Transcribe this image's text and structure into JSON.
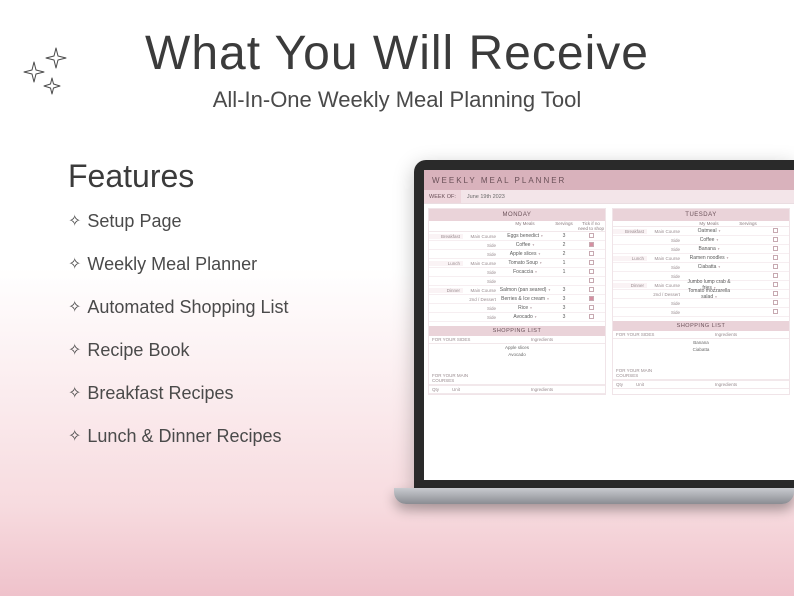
{
  "header": {
    "title": "What You Will Receive",
    "subtitle": "All-In-One Weekly Meal Planning Tool"
  },
  "features": {
    "heading": "Features",
    "items": [
      "Setup Page",
      "Weekly Meal Planner",
      "Automated Shopping List",
      "Recipe Book",
      "Breakfast Recipes",
      "Lunch & Dinner Recipes"
    ]
  },
  "planner": {
    "app_title": "WEEKLY MEAL PLANNER",
    "week_label": "WEEK OF:",
    "week_value": "June 19th 2023",
    "col_mymeals": "My Meals",
    "col_servings": "Servings",
    "col_tick": "Tick if no need to shop",
    "meal_groups": [
      "Breakfast",
      "Lunch",
      "Dinner"
    ],
    "row_labels": [
      "Main Course",
      "Side",
      "Side",
      "Main Course",
      "Side",
      "Side",
      "Main Course",
      "2nd / Dessert",
      "Side",
      "Side"
    ],
    "days": [
      {
        "name": "MONDAY",
        "rows": [
          {
            "val": "Eggs benedict",
            "serv": "3",
            "checked": false
          },
          {
            "val": "Coffee",
            "serv": "2",
            "checked": true
          },
          {
            "val": "Apple slices",
            "serv": "2",
            "checked": false
          },
          {
            "val": "Tomato Soup",
            "serv": "1",
            "checked": false
          },
          {
            "val": "Focaccia",
            "serv": "1",
            "checked": false
          },
          {
            "val": "",
            "serv": "",
            "checked": false
          },
          {
            "val": "Salmon (pan seared)",
            "serv": "3",
            "checked": false
          },
          {
            "val": "Berries & Ice cream",
            "serv": "3",
            "checked": true
          },
          {
            "val": "Rice",
            "serv": "3",
            "checked": false
          },
          {
            "val": "Avocado",
            "serv": "3",
            "checked": false
          }
        ],
        "sides_ingredients": [
          "Apple slices",
          "Avocado"
        ]
      },
      {
        "name": "TUESDAY",
        "rows": [
          {
            "val": "Oatmeal",
            "serv": "",
            "checked": false
          },
          {
            "val": "Coffee",
            "serv": "",
            "checked": false
          },
          {
            "val": "Banana",
            "serv": "",
            "checked": false
          },
          {
            "val": "Ramen noodles",
            "serv": "",
            "checked": false
          },
          {
            "val": "Ciabatta",
            "serv": "",
            "checked": false
          },
          {
            "val": "",
            "serv": "",
            "checked": false
          },
          {
            "val": "Jumbo lump crab & fries",
            "serv": "",
            "checked": false
          },
          {
            "val": "Tomato mozzarella salad",
            "serv": "",
            "checked": false
          },
          {
            "val": "",
            "serv": "",
            "checked": false
          },
          {
            "val": "",
            "serv": "",
            "checked": false
          }
        ],
        "sides_ingredients": [
          "Banana",
          "Ciabatta"
        ]
      }
    ],
    "shopping_title": "SHOPPING LIST",
    "for_sides": "FOR YOUR SIDES",
    "for_mains": "FOR YOUR MAIN COURSES",
    "ingredients_label": "Ingredients",
    "qty_label": "Qty",
    "unit_label": "Unit"
  }
}
